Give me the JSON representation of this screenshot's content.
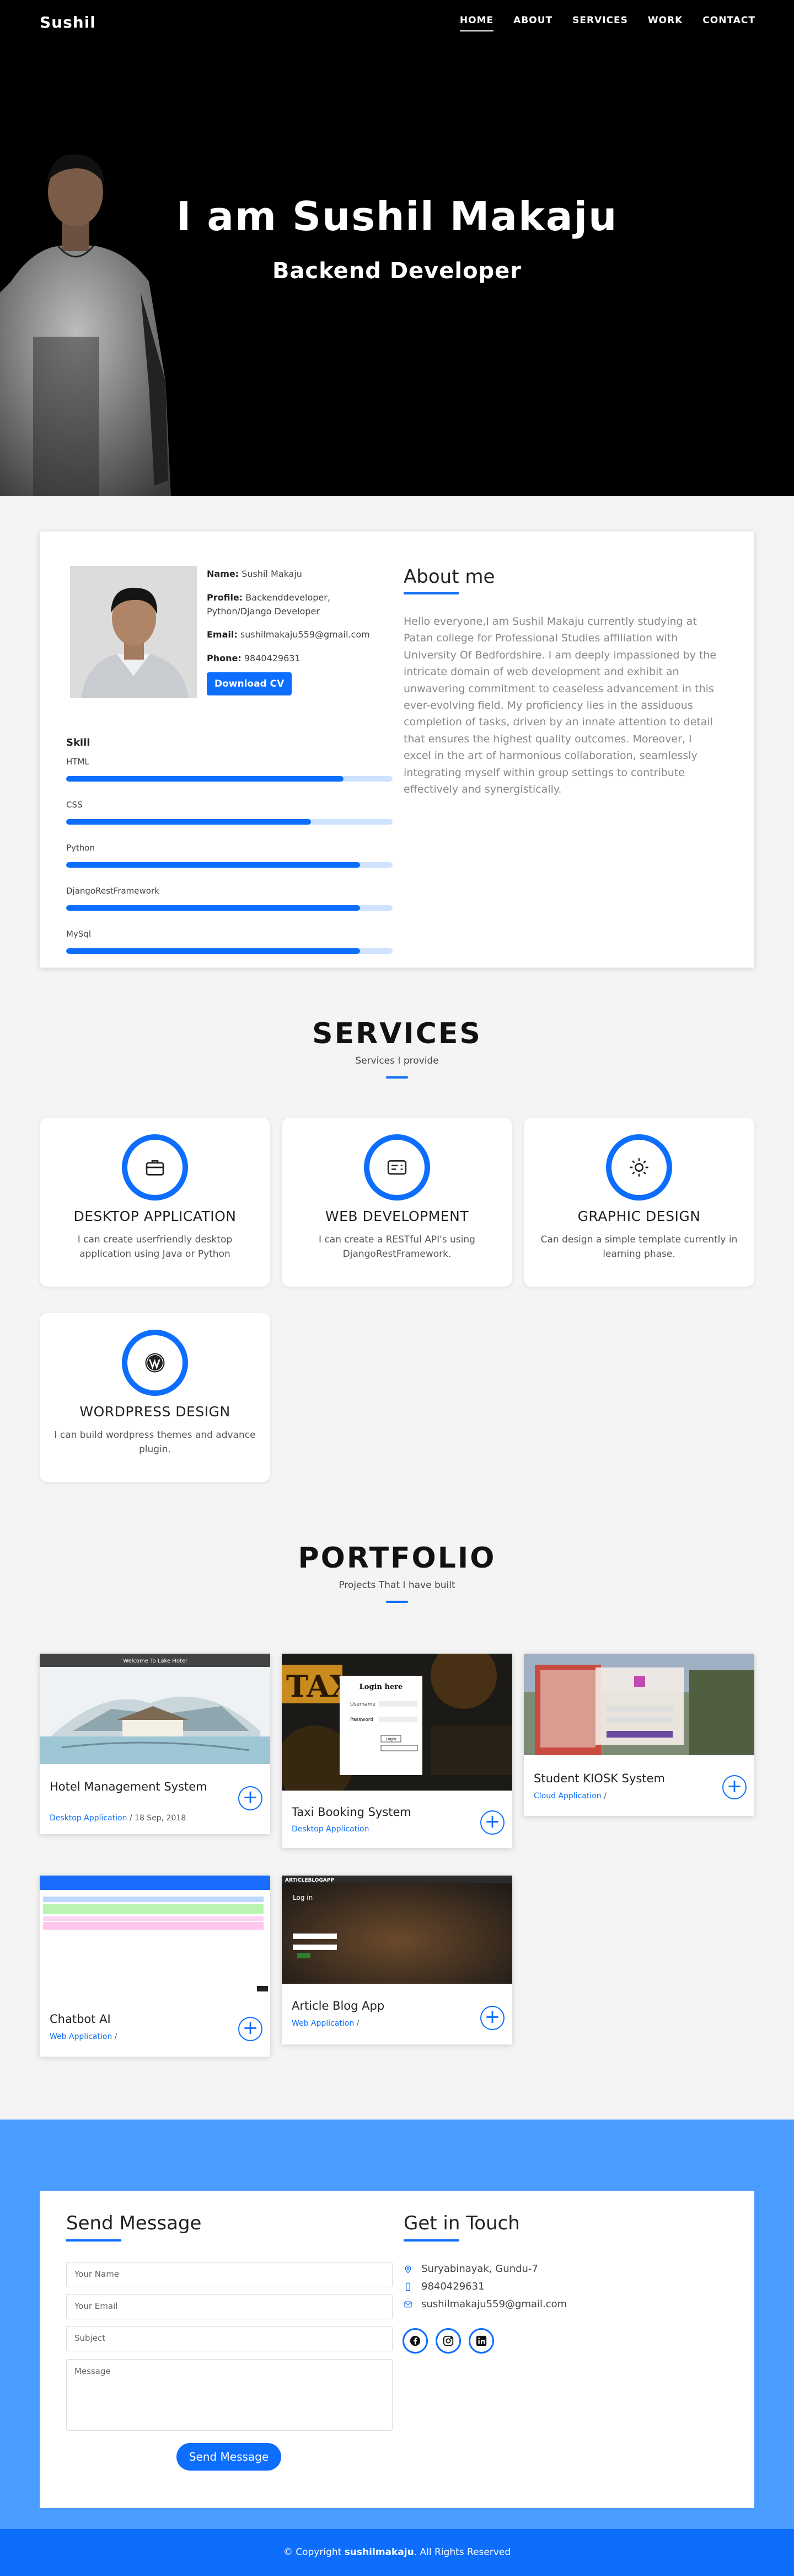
{
  "nav": {
    "brand": "Sushil",
    "items": [
      "HOME",
      "ABOUT",
      "SERVICES",
      "WORK",
      "CONTACT"
    ]
  },
  "hero": {
    "title": "I am Sushil Makaju",
    "subtitle": "Backend Developer"
  },
  "about": {
    "name_label": "Name:",
    "name_value": "Sushil Makaju",
    "profile_label": "Profile:",
    "profile_value": "Backenddeveloper, Python/Django Developer",
    "email_label": "Email:",
    "email_value": "sushilmakaju559@gmail.com",
    "phone_label": "Phone:",
    "phone_value": "9840429631",
    "download_label": "Download CV",
    "skill_title": "Skill",
    "skills": [
      {
        "label": "HTML",
        "level": 0.85
      },
      {
        "label": "CSS",
        "level": 0.75
      },
      {
        "label": "Python",
        "level": 0.9
      },
      {
        "label": "DjangoRestFramework",
        "level": 0.9
      },
      {
        "label": "MySql",
        "level": 0.9
      }
    ],
    "heading": "About me",
    "text": "Hello everyone,I am Sushil Makaju currently studying at Patan college for Professional Studies affiliation with University Of Bedfordshire. I am deeply impassioned by the intricate domain of web development and exhibit an unwavering commitment to ceaseless advancement in this ever-evolving field. My proficiency lies in the assiduous completion of tasks, driven by an innate attention to detail that ensures the highest quality outcomes. Moreover, I excel in the art of harmonious collaboration, seamlessly integrating myself within group settings to contribute effectively and synergistically."
  },
  "services": {
    "title": "SERVICES",
    "subtitle": "Services I provide",
    "items": [
      {
        "title": "DESKTOP APPLICATION",
        "desc": "I can create userfriendly desktop application using Java or Python",
        "icon": "briefcase-icon"
      },
      {
        "title": "WEB DEVELOPMENT",
        "desc": "I can create a RESTful API's using DjangoRestFramework.",
        "icon": "id-card-icon"
      },
      {
        "title": "GRAPHIC DESIGN",
        "desc": "Can design a simple template currently in learning phase.",
        "icon": "sun-icon"
      },
      {
        "title": "WORDPRESS DESIGN",
        "desc": "I can build wordpress themes and advance plugin.",
        "icon": "wordpress-icon"
      }
    ]
  },
  "portfolio": {
    "title": "PORTFOLIO",
    "subtitle": "Projects That I have built",
    "items": [
      {
        "name": "Hotel Management System",
        "category": "Desktop Application",
        "sep": " / ",
        "date": "18 Sep, 2018",
        "shot_title": "Welcome To Lake Hotel"
      },
      {
        "name": "Taxi Booking System",
        "category": "Desktop Application",
        "sep": "",
        "date": "",
        "shot_title": "Login here",
        "shot_user": "Username",
        "shot_pass": "Password",
        "shot_btn": "Login"
      },
      {
        "name": "Student KIOSK System",
        "category": "Cloud Application",
        "sep": " /",
        "date": ""
      },
      {
        "name": "Chatbot AI",
        "category": "Web Application",
        "sep": " /",
        "date": ""
      },
      {
        "name": "Article Blog App",
        "category": "Web Application",
        "sep": " /",
        "date": "",
        "shot_title": "ARTICLEBLOGAPP",
        "shot_login": "Log in"
      }
    ]
  },
  "contact": {
    "send_heading": "Send Message",
    "placeholders": {
      "name": "Your Name",
      "email": "Your Email",
      "subject": "Subject",
      "message": "Message"
    },
    "send_label": "Send Message",
    "touch_heading": "Get in Touch",
    "address": "Suryabinayak, Gundu-7",
    "phone": "9840429631",
    "email": "sushilmakaju559@gmail.com"
  },
  "footer": {
    "prefix": "© Copyright ",
    "owner": "sushilmakaju",
    "suffix": ". All Rights Reserved"
  },
  "colors": {
    "accent": "#0d6efd",
    "band": "#4a9cff"
  }
}
